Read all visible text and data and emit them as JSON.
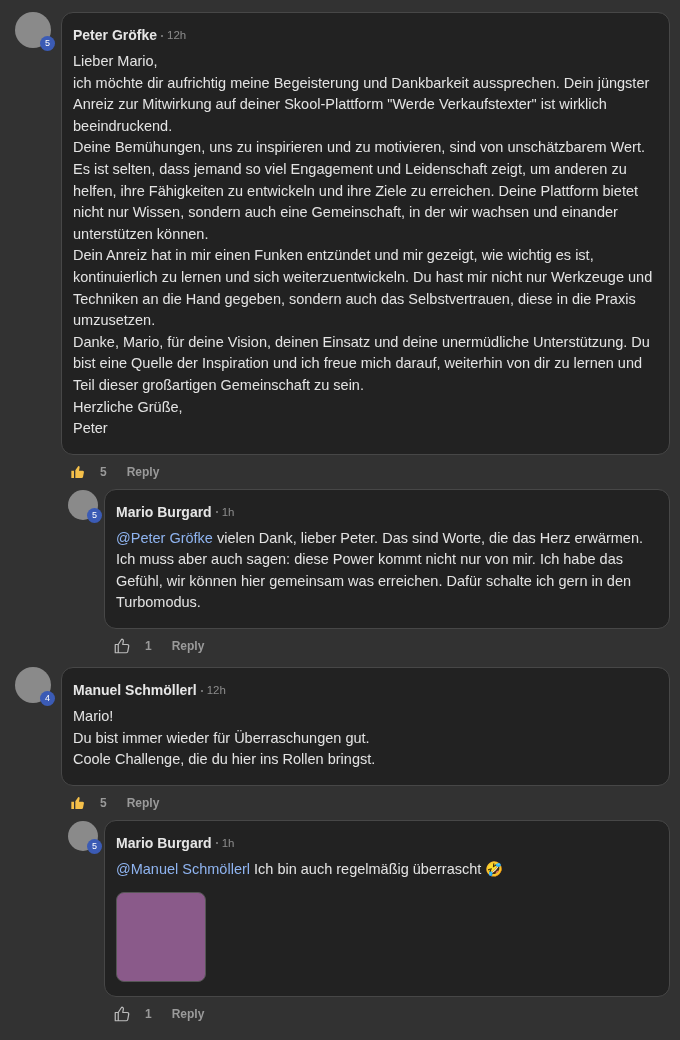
{
  "comments": [
    {
      "author": "Peter Gröfke",
      "time": "12h",
      "level": "5",
      "paragraphs": [
        "Lieber Mario,",
        "ich möchte dir aufrichtig meine Begeisterung und Dankbarkeit aussprechen. Dein jüngster Anreiz zur Mitwirkung auf deiner Skool-Plattform \"Werde Verkaufstexter\" ist wirklich beeindruckend.",
        "Deine Bemühungen, uns zu inspirieren und zu motivieren, sind von unschätzbarem Wert. Es ist selten, dass jemand so viel Engagement und Leidenschaft zeigt, um anderen zu helfen, ihre Fähigkeiten zu entwickeln und ihre Ziele zu erreichen. Deine Plattform bietet nicht nur Wissen, sondern auch eine Gemeinschaft, in der wir wachsen und einander unterstützen können.",
        "Dein Anreiz hat in mir einen Funken entzündet und mir gezeigt, wie wichtig es ist, kontinuierlich zu lernen und sich weiterzuentwickeln. Du hast mir nicht nur Werkzeuge und Techniken an die Hand gegeben, sondern auch das Selbstvertrauen, diese in die Praxis umzusetzen.",
        "Danke, Mario, für deine Vision, deinen Einsatz und deine unermüdliche Unterstützung. Du bist eine Quelle der Inspiration und ich freue mich darauf, weiterhin von dir zu lernen und Teil dieser großartigen Gemeinschaft zu sein.",
        "Herzliche Grüße,",
        "Peter"
      ],
      "likes": "5",
      "liked": true,
      "reply_label": "Reply",
      "replies": [
        {
          "author": "Mario Burgard",
          "time": "1h",
          "level": "5",
          "mention": "@Peter Gröfke",
          "text": "vielen Dank, lieber Peter. Das sind Worte, die das Herz erwärmen. Ich muss aber auch sagen: diese Power kommt nicht nur von mir. Ich habe das Gefühl, wir können hier gemeinsam was erreichen. Dafür schalte ich gern in den Turbomodus.",
          "likes": "1",
          "liked": false,
          "reply_label": "Reply"
        }
      ]
    },
    {
      "author": "Manuel Schmöllerl",
      "time": "12h",
      "level": "4",
      "paragraphs": [
        "Mario!",
        "Du bist immer wieder für Überraschungen gut.",
        "Coole Challenge, die du hier ins Rollen bringst."
      ],
      "likes": "5",
      "liked": true,
      "reply_label": "Reply",
      "replies": [
        {
          "author": "Mario Burgard",
          "time": "1h",
          "level": "5",
          "mention": "@Manuel Schmöllerl",
          "text": "Ich bin auch regelmäßig überrascht 🤣",
          "attachment": {
            "kind": "gif"
          },
          "likes": "1",
          "liked": false,
          "reply_label": "Reply"
        }
      ]
    }
  ]
}
